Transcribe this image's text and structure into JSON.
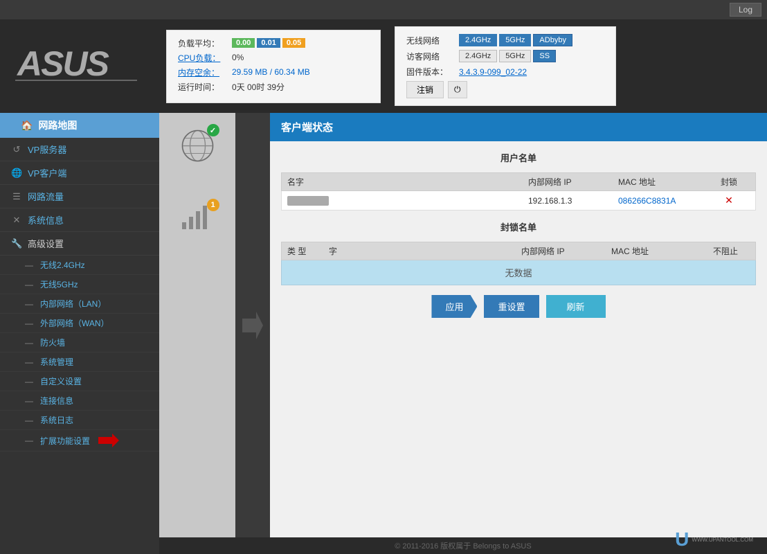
{
  "topbar": {
    "log_label": "Log"
  },
  "header": {
    "logo": "ASUS",
    "stats": {
      "load_label": "负载平均：",
      "load_values": [
        "0.00",
        "0.01",
        "0.05"
      ],
      "load_badge_colors": [
        "green",
        "blue",
        "orange"
      ],
      "cpu_label": "CPU负载：",
      "cpu_value": "0%",
      "memory_label": "内存空余：",
      "memory_value": "29.59 MB / 60.34 MB",
      "uptime_label": "运行时间：",
      "uptime_value": "0天 00时 39分"
    },
    "wireless": {
      "wifi_label": "无线网络",
      "wifi_btns": [
        "2.4GHz",
        "5GHz",
        "ADbyby"
      ],
      "guest_label": "访客网络",
      "guest_btns": [
        "2.4GHz",
        "5GHz",
        "SS"
      ],
      "firmware_label": "固件版本：",
      "firmware_value": "3.4.3.9-099_02-22",
      "cancel_label": "注销",
      "power_label": "⏻"
    }
  },
  "sidebar": {
    "title": "网路地图",
    "items": [
      {
        "label": "VP服务器",
        "icon": "↺"
      },
      {
        "label": "VP客户端",
        "icon": "🌐"
      },
      {
        "label": "网路流量",
        "icon": "☰"
      },
      {
        "label": "系统信息",
        "icon": "✕"
      },
      {
        "label": "高级设置",
        "icon": "🔧"
      }
    ],
    "subitems": [
      "无线2.4GHz",
      "无线5GHz",
      "内部网络（LAN）",
      "外部网络（WAN）",
      "防火墙",
      "系统管理",
      "自定义设置",
      "连接信息",
      "系统日志",
      "扩展功能设置"
    ]
  },
  "client_status": {
    "title": "客户端状态",
    "user_list_title": "用户名单",
    "columns": {
      "name": "名字",
      "internal_ip": "内部网络 IP",
      "mac": "MAC 地址",
      "block": "封锁"
    },
    "users": [
      {
        "name": "",
        "ip": "192.168.1.3",
        "mac": "086266C8831A",
        "blocked": "✕"
      }
    ],
    "blocked_title": "封锁名单",
    "blocked_columns": {
      "type": "类\n型",
      "name": "字",
      "ip": "内部网络 IP",
      "mac": "MAC 地址",
      "unblock": "不阻止"
    },
    "no_data": "无数据",
    "buttons": {
      "apply": "应用",
      "reset": "重设置",
      "refresh": "刷新"
    }
  },
  "footer": {
    "copyright": "© 2011-2016 版权属于 Belongs to ASUS",
    "logo_u": "U",
    "logo_sub": "WWW.UPANTOOL.COM"
  },
  "map": {
    "globe_connected": true,
    "wifi_number": "1"
  }
}
